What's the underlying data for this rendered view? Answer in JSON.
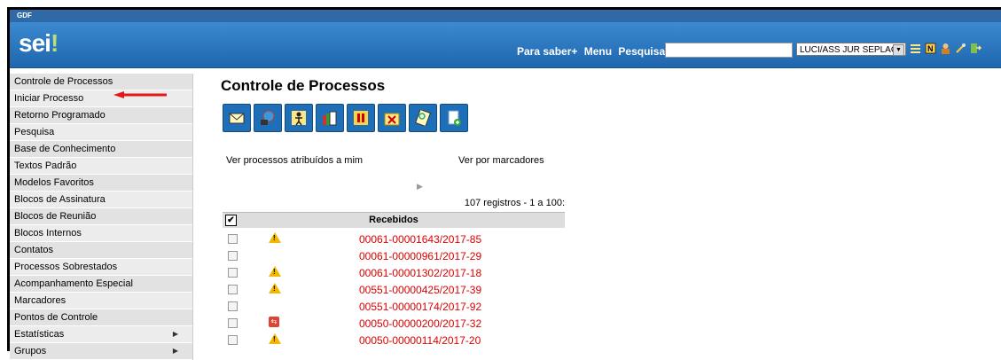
{
  "topbar": {
    "org": "GDF"
  },
  "header": {
    "logo_text": "sei",
    "logo_dot": "!",
    "nav": [
      "Para saber+",
      "Menu",
      "Pesquisa"
    ],
    "search_value": "",
    "unit_select": "LUCI/ASS JUR SEPLAG",
    "icons": [
      "list-icon",
      "notes-icon",
      "user-icon",
      "tools-icon",
      "exit-icon"
    ]
  },
  "sidebar": {
    "items": [
      {
        "label": "Controle de Processos",
        "submenu": false
      },
      {
        "label": "Iniciar Processo",
        "submenu": false
      },
      {
        "label": "Retorno Programado",
        "submenu": false
      },
      {
        "label": "Pesquisa",
        "submenu": false
      },
      {
        "label": "Base de Conhecimento",
        "submenu": false
      },
      {
        "label": "Textos Padrão",
        "submenu": false
      },
      {
        "label": "Modelos Favoritos",
        "submenu": false
      },
      {
        "label": "Blocos de Assinatura",
        "submenu": false
      },
      {
        "label": "Blocos de Reunião",
        "submenu": false
      },
      {
        "label": "Blocos Internos",
        "submenu": false
      },
      {
        "label": "Contatos",
        "submenu": false
      },
      {
        "label": "Processos Sobrestados",
        "submenu": false
      },
      {
        "label": "Acompanhamento Especial",
        "submenu": false
      },
      {
        "label": "Marcadores",
        "submenu": false
      },
      {
        "label": "Pontos de Controle",
        "submenu": false
      },
      {
        "label": "Estatísticas",
        "submenu": true
      },
      {
        "label": "Grupos",
        "submenu": true
      }
    ]
  },
  "main": {
    "title": "Controle de Processos",
    "filter_assigned": "Ver processos atribuídos a mim",
    "filter_markers": "Ver por marcadores",
    "records_info": "107 registros - 1 a 100:",
    "table_header": "Recebidos",
    "rows": [
      {
        "process": "00061-00001643/2017-85",
        "icon": "warning"
      },
      {
        "process": "00061-00000961/2017-29",
        "icon": ""
      },
      {
        "process": "00061-00001302/2017-18",
        "icon": "warning"
      },
      {
        "process": "00551-00000425/2017-39",
        "icon": "warning"
      },
      {
        "process": "00551-00000174/2017-92",
        "icon": ""
      },
      {
        "process": "00050-00000200/2017-32",
        "icon": "transfer"
      },
      {
        "process": "00050-00000114/2017-20",
        "icon": "warning"
      }
    ]
  },
  "colors": {
    "header_blue": "#1f66ad",
    "process_red": "#dd0000",
    "warning_yellow": "#f2b700"
  }
}
